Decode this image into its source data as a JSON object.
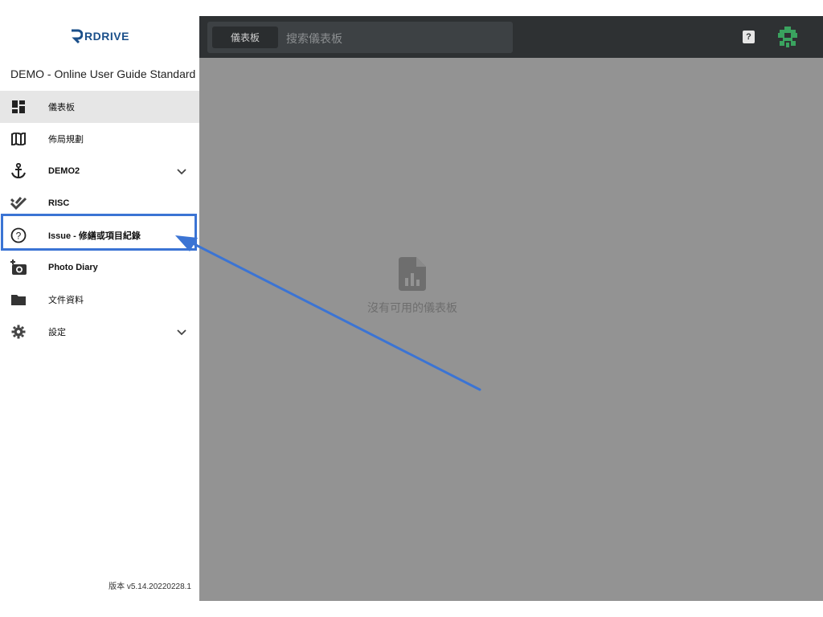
{
  "brand": {
    "logo_text": "RDRIVE"
  },
  "org_title": "DEMO - Online User Guide Standard",
  "sidebar": {
    "items": [
      {
        "label": "儀表板",
        "icon": "dashboard-icon",
        "active": true
      },
      {
        "label": "佈局規劃",
        "icon": "map-icon"
      },
      {
        "label": "DEMO2",
        "icon": "anchor-icon",
        "expandable": true
      },
      {
        "label": "RISC",
        "icon": "double-check-icon"
      },
      {
        "label": "Issue - 修繕或項目紀錄",
        "icon": "help-circle-icon"
      },
      {
        "label": "Photo Diary",
        "icon": "add-photo-icon"
      },
      {
        "label": "文件資料",
        "icon": "folder-icon"
      },
      {
        "label": "設定",
        "icon": "gear-icon",
        "expandable": true
      }
    ],
    "version": "版本 v5.14.20220228.1"
  },
  "topbar": {
    "search_chip": "儀表板",
    "search_placeholder": "搜索儀表板",
    "help_label": "?"
  },
  "empty_state": {
    "text": "沒有可用的儀表板"
  },
  "colors": {
    "topbar": "#2e3133",
    "main_bg": "#939393",
    "annotation": "#3b74d4",
    "brand": "#1a4f8a",
    "avatar": "#3aa35f"
  }
}
